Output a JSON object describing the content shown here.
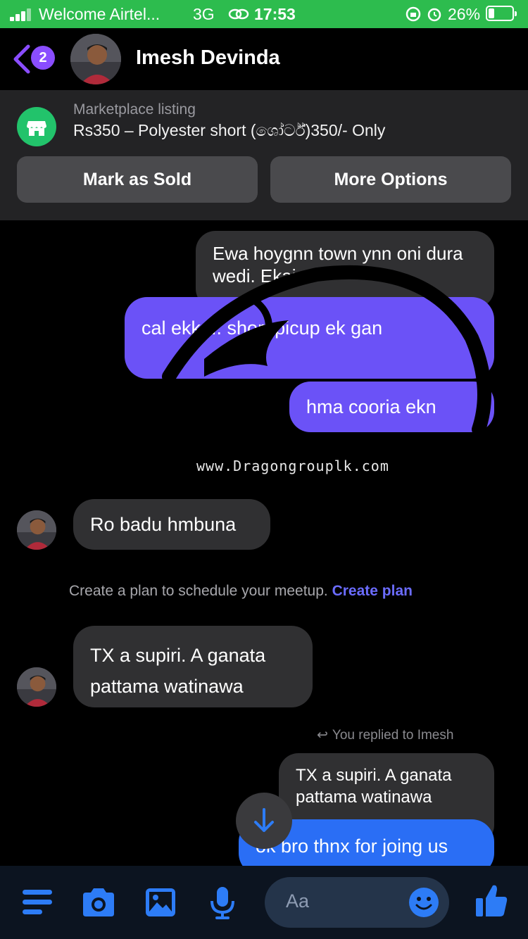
{
  "status_bar": {
    "carrier": "Welcome Airtel...",
    "network": "3G",
    "time": "17:53",
    "battery": "26%",
    "battery_level": 0.26
  },
  "header": {
    "unread_count": "2",
    "contact_name": "Imesh Devinda"
  },
  "marketplace": {
    "label": "Marketplace listing",
    "title": "Rs350 – Polyester short (ශෝර්ට්)350/- Only",
    "mark_sold_label": "Mark as Sold",
    "more_options_label": "More Options"
  },
  "messages": [
    {
      "sender": "them",
      "text": "Ewa hoygnn town ynn oni dura wedi. Ekai"
    },
    {
      "sender": "me",
      "text": "cal ekk ... short picup ek gan"
    },
    {
      "sender": "me",
      "text": "hma cooria ekn"
    },
    {
      "sender": "them",
      "text": "Ro badu hmbuna"
    },
    {
      "sender": "them",
      "text": "TX a supiri. A ganata pattama watinawa"
    },
    {
      "sender": "me",
      "text": "ok bro thnx for joing us"
    }
  ],
  "watermark": "www.Dragongrouplk.com",
  "meetup": {
    "prompt": "Create a plan to schedule your meetup.",
    "link": "Create plan"
  },
  "reply_context": {
    "label": "You replied to Imesh",
    "quoted": "TX a supiri. A ganata pattama watinawa"
  },
  "composer": {
    "placeholder": "Aa"
  },
  "colors": {
    "status_green": "#2dbc4e",
    "purple_bubble": "#6b52f7",
    "blue_bubble": "#2a6ef5",
    "icon_blue": "#2d7cf6"
  }
}
